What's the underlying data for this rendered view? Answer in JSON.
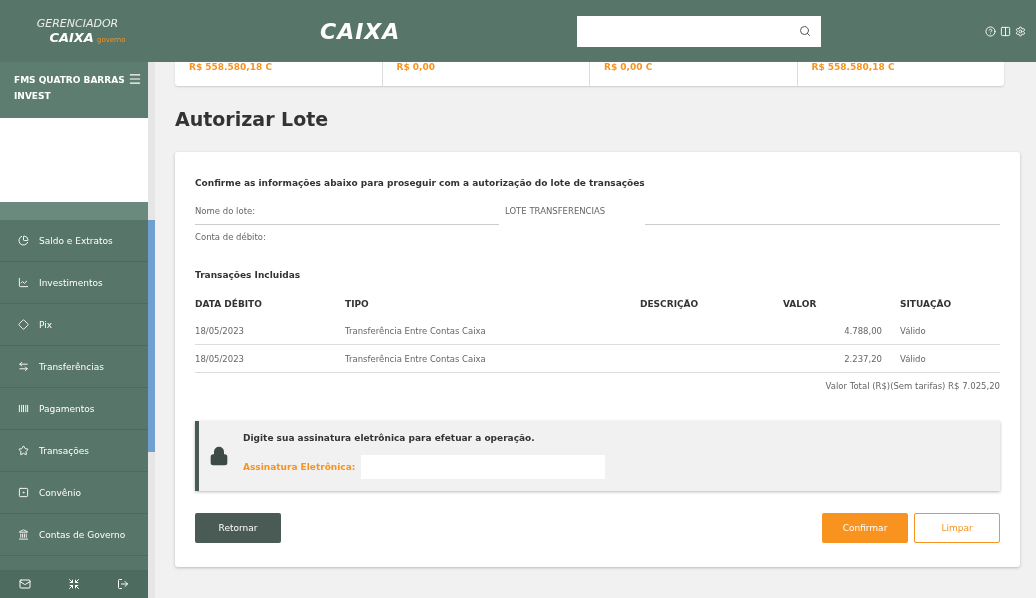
{
  "header": {
    "logo_top": "GERENCIADOR",
    "logo_brand": "CAIXA",
    "logo_tag": "governo",
    "brand": "CAIXA"
  },
  "sidebar": {
    "account": "FMS QUATRO BARRAS INVEST",
    "items": [
      {
        "label": "Saldo e Extratos"
      },
      {
        "label": "Investimentos"
      },
      {
        "label": "Pix"
      },
      {
        "label": "Transferências"
      },
      {
        "label": "Pagamentos"
      },
      {
        "label": "Transações"
      },
      {
        "label": "Convênio"
      },
      {
        "label": "Contas de Governo"
      }
    ]
  },
  "balances": [
    "R$ 558.580,18 C",
    "R$ 0,00",
    "R$ 0,00 C",
    "R$ 558.580,18 C"
  ],
  "page_title": "Autorizar Lote",
  "card": {
    "intro": "Confirme as informações abaixo para proseguir com a autorização do lote de transações",
    "fields": [
      {
        "label": "Nome do lote:",
        "value": "LOTE TRANSFERENCIAS"
      },
      {
        "label": "Conta de débito:"
      }
    ],
    "section": "Transações Incluidas",
    "table": {
      "columns": [
        "DATA DÉBITO",
        "TIPO",
        "DESCRIÇÃO",
        "VALOR",
        "SITUAÇÃO"
      ],
      "rows": [
        [
          "18/05/2023",
          "Transferência Entre Contas Caixa",
          null,
          "4.788,00",
          "Válido"
        ],
        [
          "18/05/2023",
          "Transferência Entre Contas Caixa",
          null,
          "2.237,20",
          "Válido"
        ]
      ]
    },
    "total": "Valor Total (R$)(Sem tarifas) R$ 7.025,20",
    "signature": {
      "prompt": "Digite sua assinatura eletrônica para efetuar a operação.",
      "label": "Assinatura Eletrônica:"
    },
    "buttons": [
      {
        "label": "Retornar",
        "kind": "dark"
      },
      {
        "label": "Confirmar",
        "kind": "primary"
      },
      {
        "label": "Limpar",
        "kind": "outline"
      }
    ]
  }
}
